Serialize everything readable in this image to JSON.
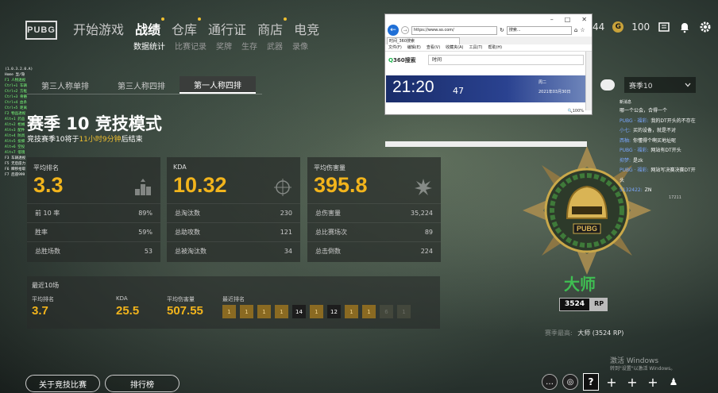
{
  "header": {
    "logo": "PUBG",
    "nav": [
      {
        "label": "开始游戏",
        "active": false,
        "dot": false
      },
      {
        "label": "战绩",
        "active": true,
        "dot": true
      },
      {
        "label": "仓库",
        "active": false,
        "dot": true
      },
      {
        "label": "通行证",
        "active": false,
        "dot": false
      },
      {
        "label": "商店",
        "active": false,
        "dot": true
      },
      {
        "label": "电竞",
        "active": false,
        "dot": false
      }
    ],
    "subnav": [
      "数据统计",
      "比赛记录",
      "奖牌",
      "生存",
      "武器",
      "录像"
    ],
    "currency_bp": "44",
    "currency_g": "100",
    "coin_label": "G"
  },
  "debug_lines": [
    "(1.0.3.2.0.A)",
    "Home 显/隐",
    "F1 人物透视",
    "Ctrl+1 车辆",
    "Ctrl+2 方框",
    "Ctrl+3 骨骼",
    "Ctrl+4 血条",
    "Ctrl+5 距离",
    "F2 物品透视",
    "Alt+1 药品",
    "Alt+2 枪械",
    "Alt+3 配件",
    "Alt+4 防具",
    "Alt+5 投掷",
    "Alt+6 空投",
    "Alt+7 倍镜",
    "F3 车辆透视",
    "F5 无后座力",
    "F6 瞬移拾取",
    "F7 后座999"
  ],
  "mode_tabs": [
    {
      "label": "第三人称单排",
      "active": false
    },
    {
      "label": "第三人称四排",
      "active": false
    },
    {
      "label": "第一人称四排",
      "active": true
    }
  ],
  "season": {
    "title": "赛季 10 竞技模式",
    "sub_pre": "竞技赛季10将于",
    "sub_hl": "11小时9分钟",
    "sub_post": "后结束"
  },
  "cards": [
    {
      "label": "平均排名",
      "value": "3.3",
      "icon": "podium-icon",
      "rows": [
        [
          "前 10 率",
          "89%"
        ],
        [
          "胜率",
          "59%"
        ],
        [
          "总胜场数",
          "53"
        ]
      ]
    },
    {
      "label": "KDA",
      "value": "10.32",
      "icon": "crosshair-icon",
      "rows": [
        [
          "总淘汰数",
          "230"
        ],
        [
          "总助攻数",
          "121"
        ],
        [
          "总被淘汰数",
          "34"
        ]
      ]
    },
    {
      "label": "平均伤害量",
      "value": "395.8",
      "icon": "explosion-icon",
      "rows": [
        [
          "总伤害量",
          "35,224"
        ],
        [
          "总比赛场次",
          "89"
        ],
        [
          "总击倒数",
          "224"
        ]
      ]
    }
  ],
  "recent": {
    "title": "最近10场",
    "avg_rank_label": "平均排名",
    "avg_rank": "3.7",
    "kda_label": "KDA",
    "kda": "25.5",
    "dmg_label": "平均伤害量",
    "dmg": "507.55",
    "ranks_label": "最近排名",
    "ranks": [
      {
        "v": "1",
        "s": "y"
      },
      {
        "v": "1",
        "s": "y"
      },
      {
        "v": "1",
        "s": "y"
      },
      {
        "v": "1",
        "s": "y"
      },
      {
        "v": "14",
        "s": "d"
      },
      {
        "v": "1",
        "s": "y"
      },
      {
        "v": "12",
        "s": "d"
      },
      {
        "v": "1",
        "s": "y"
      },
      {
        "v": "1",
        "s": "y"
      },
      {
        "v": "6",
        "s": "e"
      },
      {
        "v": "1",
        "s": "e"
      }
    ]
  },
  "bottom_buttons": [
    "关于竞技比赛",
    "排行榜"
  ],
  "rank": {
    "name": "大师",
    "points": "3524",
    "unit": "RP",
    "best_label": "赛季最高:",
    "best": "大师 (3524 RP)",
    "emblem_text": "PUBG"
  },
  "season_select": "赛季10",
  "chat": {
    "header": "新消息",
    "messages": [
      {
        "name": "",
        "text": "哪一个公会，合得一个"
      },
      {
        "name": "PUBG · 福彩:",
        "text": "我的DT开头的不存在"
      },
      {
        "name": "小七:",
        "text": "买的设备，就是不对"
      },
      {
        "name": "西柚:",
        "text": "你懂得个啊买地址呢"
      },
      {
        "name": "PUBG · 福彩:",
        "text": "网站有DT开头"
      },
      {
        "name": "抑梦:",
        "text": "是zk"
      },
      {
        "name": "PUBG · 福彩:",
        "text": "网站写决赛决赛DT开头"
      },
      {
        "name": "5132422:",
        "text": "ZN"
      }
    ],
    "count": "17211"
  },
  "windows": {
    "line1": "激活 Windows",
    "line2": "转到\"设置\"以激活 Windows。"
  },
  "browser": {
    "url": "https://www.so.com/",
    "search": "搜索...",
    "tab": "时间_360搜索",
    "menu": [
      "文件(F)",
      "编辑(E)",
      "查看(V)",
      "收藏夹(A)",
      "工具(T)",
      "帮助(H)"
    ],
    "logo": "360搜索",
    "query": "时间",
    "time": "21:20",
    "sec": "47",
    "weekday": "周二",
    "date": "2021年03月30日",
    "zoom": "100%"
  }
}
